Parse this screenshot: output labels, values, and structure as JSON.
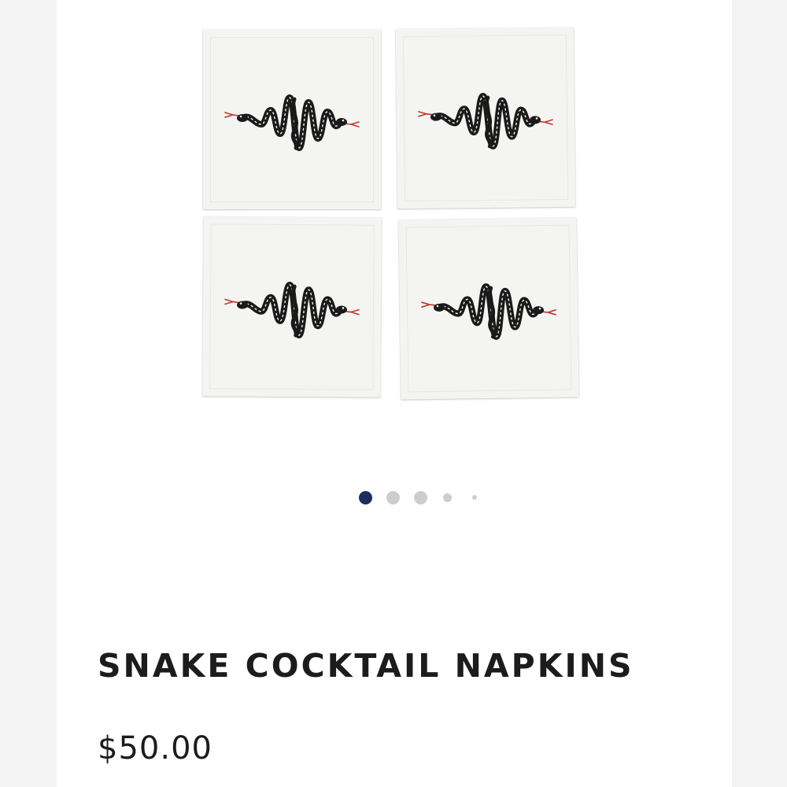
{
  "product": {
    "title": "SNAKE COCKTAIL NAPKINS",
    "price": "$50.00"
  },
  "gallery": {
    "image_icon": "snake-napkin-set",
    "pagination": {
      "count": 5,
      "active_index": 0
    }
  },
  "colors": {
    "active_dot": "#1c2d5e",
    "inactive_dot": "#cdcdcd",
    "text": "#1c1c1c",
    "napkin": "#f4f4f2",
    "snake": "#1a1a1a",
    "tongue": "#c0392b"
  }
}
